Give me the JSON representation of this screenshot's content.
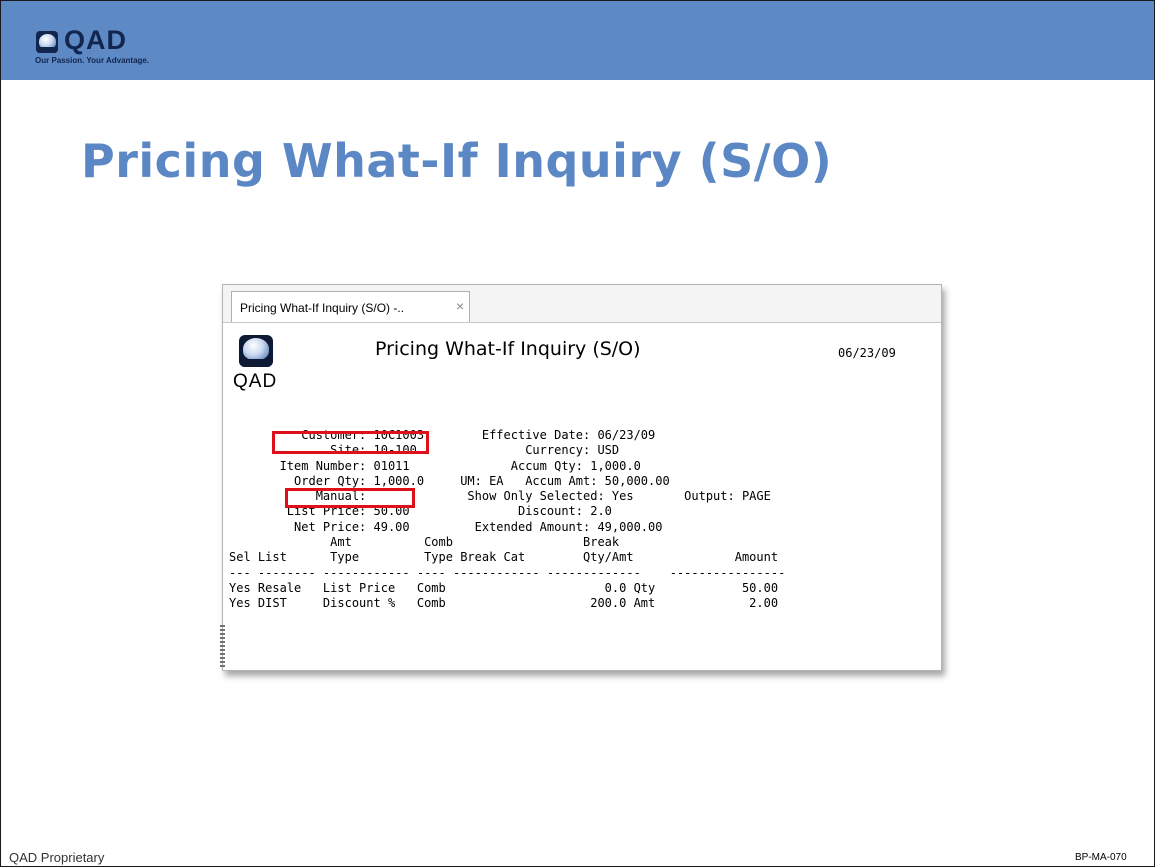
{
  "brand": {
    "logo_text": "QAD",
    "tagline": "Our Passion. Your Advantage."
  },
  "slide": {
    "title": "Pricing What-If Inquiry (S/O)",
    "footer_left": "QAD Proprietary",
    "footer_right": "BP-MA-070"
  },
  "app": {
    "tab_label": "Pricing What-If Inquiry (S/O) -..",
    "tab_close": "×",
    "logo_text": "QAD",
    "report_title": "Pricing What-If Inquiry (S/O)",
    "report_date": "06/23/09",
    "report_lines": [
      "          Customer: 10C1003        Effective Date: 06/23/09",
      "              Site: 10-100               Currency: USD",
      "       Item Number: 01011              Accum Qty: 1,000.0",
      "         Order Qty: 1,000.0     UM: EA   Accum Amt: 50,000.00",
      "            Manual:              Show Only Selected: Yes       Output: PAGE",
      "",
      "        List Price: 50.00               Discount: 2.0",
      "         Net Price: 49.00         Extended Amount: 49,000.00",
      "",
      "              Amt          Comb                  Break",
      "Sel List      Type         Type Break Cat        Qty/Amt              Amount",
      "--- -------- ------------ ---- ------------ -------------    ----------------",
      "Yes Resale   List Price   Comb                      0.0 Qty            50.00",
      "Yes DIST     Discount %   Comb                    200.0 Amt             2.00"
    ]
  }
}
